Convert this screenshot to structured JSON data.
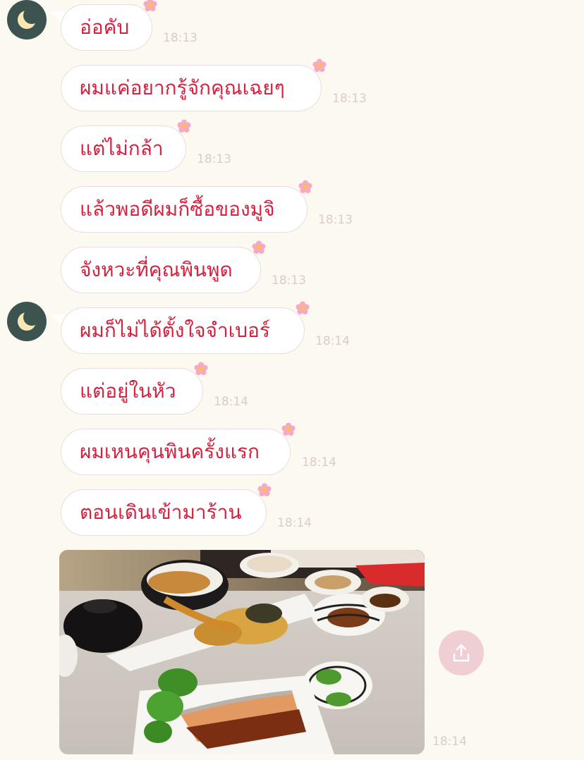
{
  "theme": {
    "accent": "#d6213f",
    "bubble_bg": "#ffffff",
    "background": "#fcf9f1",
    "avatar_bg": "#3d5350"
  },
  "messages": [
    {
      "text": "อ่อคับ",
      "time": "18:13"
    },
    {
      "text": "ผมแค่อยากรู้จักคุณเฉยๆ",
      "time": "18:13"
    },
    {
      "text": "แต่ไม่กล้า",
      "time": "18:13"
    },
    {
      "text": "แล้วพอดีผมก็ซื้อของมูจิ",
      "time": "18:13"
    },
    {
      "text": "จังหวะที่คุณพินพูด",
      "time": "18:13"
    },
    {
      "text": "ผมก็ไม่ได้ตั้งใจจำเบอร์",
      "time": "18:14"
    },
    {
      "text": "แต่อยู่ในหัว",
      "time": "18:14"
    },
    {
      "text": "ผมเหนคุนพินครั้งแรก",
      "time": "18:14"
    },
    {
      "text": "ตอนเดินเข้ามาร้าน",
      "time": "18:14"
    }
  ],
  "photo": {
    "time": "18:14",
    "icon": "share-icon"
  },
  "avatar_icon": "moon-icon"
}
